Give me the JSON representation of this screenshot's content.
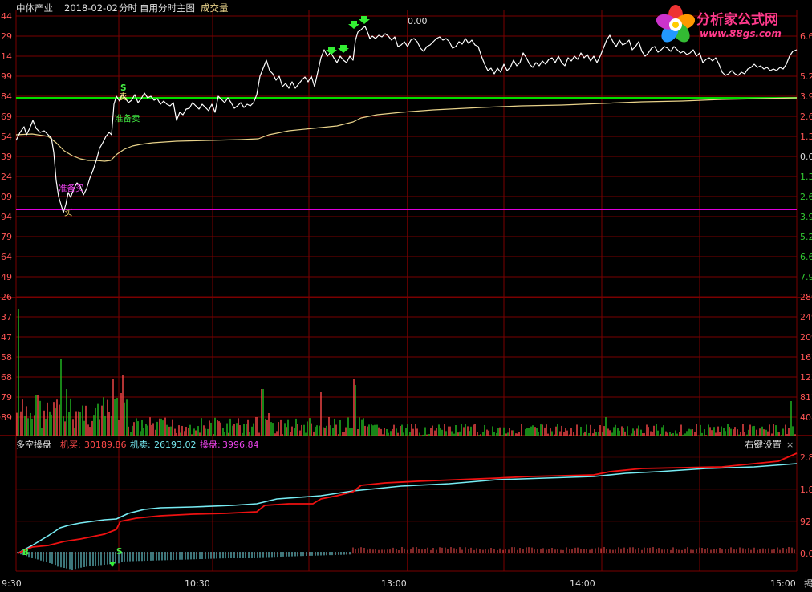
{
  "header": {
    "stock_name": "中体产业",
    "date": "2018-02-02",
    "view": "分时",
    "main_chart_name": "自用分时主图",
    "sub_label": "成交量",
    "center_readout": "0.00"
  },
  "logo": {
    "text": "分析家公式网",
    "url": "www.88gs.com"
  },
  "price_axis": {
    "left_labels": [
      "44",
      "29",
      "14",
      "99",
      "84",
      "69",
      "54",
      "39",
      "24",
      "09",
      "94",
      "79",
      "64",
      "49"
    ],
    "right_labels": [
      "6.6",
      "5.2",
      "3.9",
      "2.6",
      "1.3",
      "0.0",
      "1.3",
      "2.6",
      "3.9",
      "5.2",
      "6.6",
      "7.9"
    ]
  },
  "volume_axis": {
    "left_labels": [
      "526",
      "537",
      "47",
      "358",
      "268",
      "79",
      "089"
    ],
    "right_labels": [
      "280",
      "249",
      "209",
      "167",
      "122",
      "817",
      "408"
    ]
  },
  "indicator": {
    "name": "多空操盘",
    "buy_label": "机买:",
    "buy_value": "30189.86",
    "sell_label": "机卖:",
    "sell_value": "26193.02",
    "op_label": "操盘:",
    "op_value": "3996.84",
    "settings_label": "右键设置",
    "close_glyph": "×",
    "right_labels": [
      "2.8",
      "1.8",
      "92",
      "0.0"
    ]
  },
  "time_axis": {
    "labels": [
      "9:30",
      "10:30",
      "13:00",
      "14:00",
      "15:00"
    ],
    "end_glyph": "揭"
  },
  "annotations": {
    "prepare_sell": "准备卖",
    "prepare_buy": "准备买",
    "sell_mark": "卖",
    "buy_mark": "买",
    "s_mark": "S",
    "b_mark": "B"
  },
  "colors": {
    "grid": "#7a0000",
    "price_line": "#ffffff",
    "avg_line": "#e8d28a",
    "green_level": "#00dd00",
    "magenta_level": "#dd00dd",
    "up_bar": "#ff4a4a",
    "down_bar": "#22c022",
    "buy_line": "#ee1111",
    "sell_line": "#77ecf4",
    "op_label": "#ee44ee"
  },
  "chart_data": {
    "type": "line",
    "title": "自用分时主图",
    "date": "2018-02-02",
    "green_level_pct": 3.9,
    "magenta_level_pct": -3.9,
    "price_pct_series": [
      {
        "time": "9:30",
        "pct": 0.4
      },
      {
        "time": "9:35",
        "pct": 1.0
      },
      {
        "time": "9:40",
        "pct": -1.3
      },
      {
        "time": "9:45",
        "pct": -3.9
      },
      {
        "time": "9:50",
        "pct": -2.6
      },
      {
        "time": "9:55",
        "pct": -2.3
      },
      {
        "time": "10:00",
        "pct": -0.5
      },
      {
        "time": "10:05",
        "pct": 3.9
      },
      {
        "time": "10:15",
        "pct": 3.6
      },
      {
        "time": "10:20",
        "pct": 2.6
      },
      {
        "time": "10:30",
        "pct": 3.3
      },
      {
        "time": "10:50",
        "pct": 3.5
      },
      {
        "time": "11:00",
        "pct": 5.5
      },
      {
        "time": "11:10",
        "pct": 4.9
      },
      {
        "time": "11:20",
        "pct": 5.9
      },
      {
        "time": "11:25",
        "pct": 5.7
      },
      {
        "time": "11:30",
        "pct": 6.9
      },
      {
        "time": "13:00",
        "pct": 6.3
      },
      {
        "time": "13:30",
        "pct": 6.0
      },
      {
        "time": "13:45",
        "pct": 5.3
      },
      {
        "time": "14:00",
        "pct": 6.1
      },
      {
        "time": "14:10",
        "pct": 6.5
      },
      {
        "time": "14:30",
        "pct": 5.9
      },
      {
        "time": "14:45",
        "pct": 5.2
      },
      {
        "time": "15:00",
        "pct": 5.8
      }
    ],
    "indicator_series": [
      {
        "name": "机买",
        "last": 30189.86
      },
      {
        "name": "机卖",
        "last": 26193.02
      },
      {
        "name": "操盘",
        "last": 3996.84
      }
    ]
  }
}
